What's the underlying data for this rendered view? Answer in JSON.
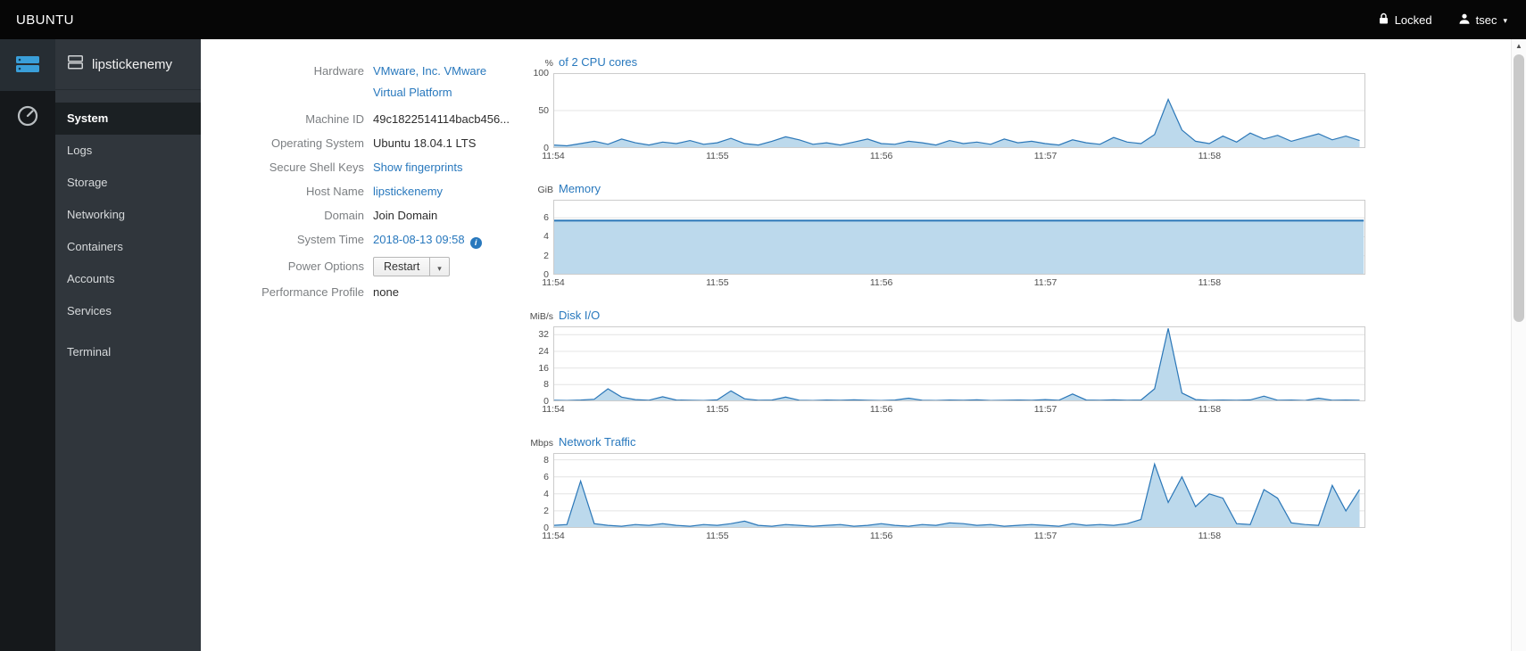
{
  "colors": {
    "link": "#2878bd",
    "topbar_bg": "#060606",
    "sidebar_bg": "#30363c",
    "accent_blue": "#3a9fd9"
  },
  "topbar": {
    "brand": "UBUNTU",
    "locked_label": "Locked",
    "user": "tsec"
  },
  "sidebar": {
    "host": "lipstickenemy",
    "items": [
      {
        "label": "System",
        "active": true
      },
      {
        "label": "Logs"
      },
      {
        "label": "Storage"
      },
      {
        "label": "Networking"
      },
      {
        "label": "Containers"
      },
      {
        "label": "Accounts"
      },
      {
        "label": "Services"
      },
      {
        "label": "Terminal",
        "gap": true
      }
    ]
  },
  "info": {
    "hardware_label": "Hardware",
    "hardware_value_1": "VMware, Inc. VMware",
    "hardware_value_2": "Virtual Platform",
    "machine_id_label": "Machine ID",
    "machine_id_value": "49c1822514114bacb456...",
    "os_label": "Operating System",
    "os_value": "Ubuntu 18.04.1 LTS",
    "ssh_label": "Secure Shell Keys",
    "ssh_value": "Show fingerprints",
    "hostname_label": "Host Name",
    "hostname_value": "lipstickenemy",
    "domain_label": "Domain",
    "domain_value": "Join Domain",
    "time_label": "System Time",
    "time_value": "2018-08-13 09:58",
    "power_label": "Power Options",
    "power_button": "Restart",
    "profile_label": "Performance Profile",
    "profile_value": "none"
  },
  "chart_data": [
    {
      "type": "area",
      "title": "of 2 CPU cores",
      "unit": "%",
      "x_tick_labels": [
        "11:54",
        "11:55",
        "11:56",
        "11:57",
        "11:58"
      ],
      "x_ticks": [
        0,
        1,
        2,
        3,
        4
      ],
      "x_max": 4.95,
      "x_step": 0.0833,
      "y_ticks": [
        0,
        50,
        100
      ],
      "y_max": 100,
      "color": "#2b77b8",
      "fill": "#bcd9ec",
      "line_width": 1.2,
      "values": [
        4,
        3,
        6,
        9,
        5,
        12,
        7,
        4,
        8,
        6,
        10,
        5,
        7,
        13,
        6,
        4,
        9,
        15,
        11,
        5,
        7,
        4,
        8,
        12,
        6,
        5,
        9,
        7,
        4,
        10,
        6,
        8,
        5,
        12,
        7,
        9,
        6,
        4,
        11,
        7,
        5,
        14,
        8,
        6,
        18,
        65,
        24,
        9,
        6,
        16,
        8,
        20,
        12,
        17,
        9,
        14,
        19,
        11,
        16,
        10
      ]
    },
    {
      "type": "area",
      "title": "Memory",
      "unit": "GiB",
      "x_tick_labels": [
        "11:54",
        "11:55",
        "11:56",
        "11:57",
        "11:58"
      ],
      "x_ticks": [
        0,
        1,
        2,
        3,
        4
      ],
      "x_max": 4.95,
      "x_step": 0.26,
      "y_ticks": [
        0,
        2,
        4,
        6
      ],
      "y_max": 7.9,
      "color": "#2b77b8",
      "fill": "#bcd9ec",
      "line_width": 2,
      "values": [
        5.7,
        5.7,
        5.7,
        5.7,
        5.7,
        5.7,
        5.7,
        5.7,
        5.7,
        5.7,
        5.7,
        5.7,
        5.7,
        5.7,
        5.7,
        5.7,
        5.7,
        5.7,
        5.7,
        5.7
      ]
    },
    {
      "type": "area",
      "title": "Disk I/O",
      "unit": "MiB/s",
      "x_tick_labels": [
        "11:54",
        "11:55",
        "11:56",
        "11:57",
        "11:58"
      ],
      "x_ticks": [
        0,
        1,
        2,
        3,
        4
      ],
      "x_max": 4.95,
      "x_step": 0.0833,
      "y_ticks": [
        0,
        8,
        16,
        24,
        32
      ],
      "y_max": 36,
      "color": "#2b77b8",
      "fill": "#bcd9ec",
      "line_width": 1.2,
      "values": [
        0.5,
        0.4,
        0.6,
        1.0,
        6,
        2,
        0.8,
        0.5,
        2.2,
        0.6,
        0.5,
        0.4,
        0.7,
        5,
        1.2,
        0.5,
        0.6,
        2,
        0.5,
        0.4,
        0.6,
        0.5,
        0.7,
        0.5,
        0.4,
        0.6,
        1.5,
        0.5,
        0.4,
        0.6,
        0.5,
        0.7,
        0.4,
        0.5,
        0.6,
        0.5,
        0.8,
        0.5,
        3.5,
        0.6,
        0.5,
        0.7,
        0.5,
        0.6,
        6,
        35,
        4,
        0.8,
        0.5,
        0.6,
        0.5,
        0.7,
        2.5,
        0.5,
        0.6,
        0.4,
        1.5,
        0.5,
        0.6,
        0.5
      ]
    },
    {
      "type": "area",
      "title": "Network Traffic",
      "unit": "Mbps",
      "x_tick_labels": [
        "11:54",
        "11:55",
        "11:56",
        "11:57",
        "11:58"
      ],
      "x_ticks": [
        0,
        1,
        2,
        3,
        4
      ],
      "x_max": 4.95,
      "x_step": 0.0833,
      "y_ticks": [
        0,
        2,
        4,
        6,
        8
      ],
      "y_max": 8.8,
      "color": "#2b77b8",
      "fill": "#bcd9ec",
      "line_width": 1.2,
      "values": [
        0.3,
        0.4,
        5.5,
        0.5,
        0.3,
        0.2,
        0.4,
        0.3,
        0.5,
        0.3,
        0.2,
        0.4,
        0.3,
        0.5,
        0.8,
        0.3,
        0.2,
        0.4,
        0.3,
        0.2,
        0.3,
        0.4,
        0.2,
        0.3,
        0.5,
        0.3,
        0.2,
        0.4,
        0.3,
        0.6,
        0.5,
        0.3,
        0.4,
        0.2,
        0.3,
        0.4,
        0.3,
        0.2,
        0.5,
        0.3,
        0.4,
        0.3,
        0.5,
        1.0,
        7.5,
        3.0,
        6.0,
        2.5,
        4.0,
        3.5,
        0.5,
        0.4,
        4.5,
        3.5,
        0.6,
        0.4,
        0.3,
        5.0,
        2.0,
        4.5
      ]
    }
  ]
}
